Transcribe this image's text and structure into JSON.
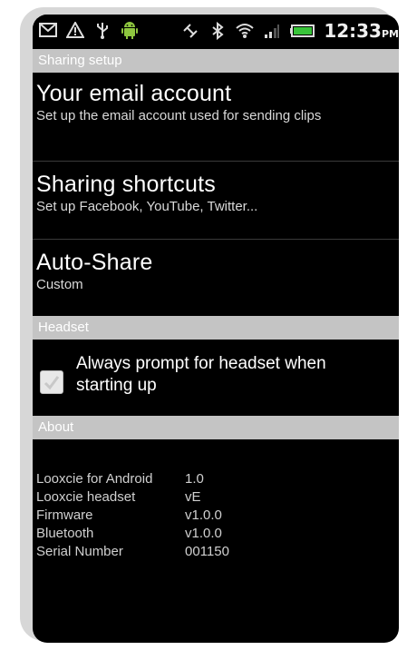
{
  "status_bar": {
    "time": "12:33",
    "ampm": "PM",
    "icons_left": [
      "gmail-icon",
      "warning-icon",
      "usb-icon",
      "android-icon"
    ],
    "icons_right": [
      "gps-icon",
      "bluetooth-icon",
      "wifi-icon",
      "signal-icon",
      "battery-icon"
    ]
  },
  "sections": {
    "sharing_setup": "Sharing setup",
    "headset": "Headset",
    "about": "About"
  },
  "sharing_items": [
    {
      "title": "Your email account",
      "subtitle": "Set up the email account used for sending clips"
    },
    {
      "title": "Sharing shortcuts",
      "subtitle": "Set up Facebook, YouTube, Twitter..."
    },
    {
      "title": "Auto-Share",
      "subtitle": "Custom"
    }
  ],
  "headset": {
    "checkbox_label": "Always prompt for headset when starting up",
    "checked": true
  },
  "about": [
    {
      "label": "Looxcie for Android",
      "value": "1.0"
    },
    {
      "label": "Looxcie headset",
      "value": "vE"
    },
    {
      "label": "Firmware",
      "value": "v1.0.0"
    },
    {
      "label": "Bluetooth",
      "value": "v1.0.0"
    },
    {
      "label": "Serial Number",
      "value": "001150"
    }
  ],
  "colors": {
    "background": "#000000",
    "section_header": "#c4c4c4",
    "frame": "#d7d7d7"
  }
}
